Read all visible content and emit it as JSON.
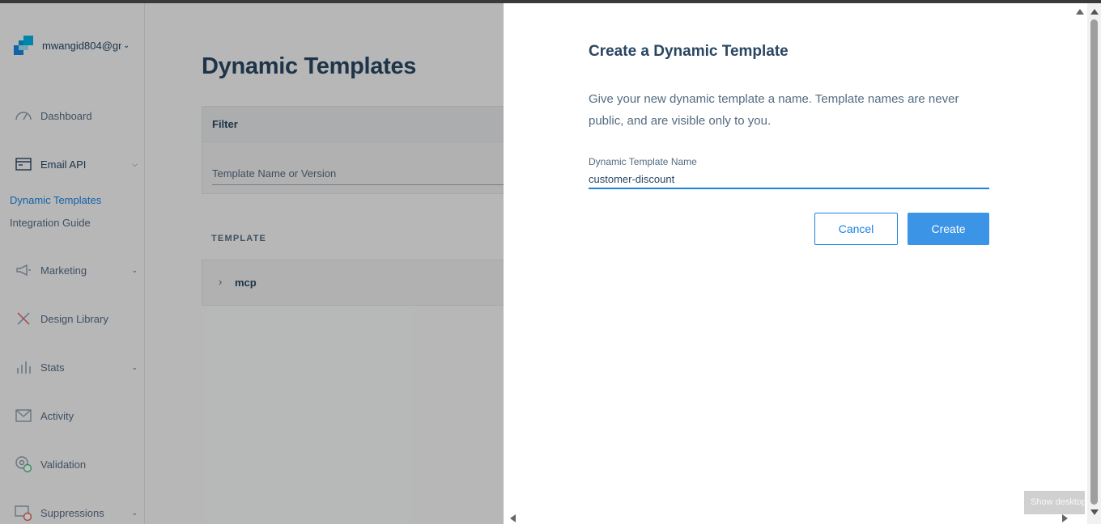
{
  "sidebar": {
    "account_name": "mwangid804@gn",
    "items": [
      {
        "label": "Dashboard",
        "icon": "dashboard-gauge-icon"
      },
      {
        "label": "Email API",
        "icon": "email-api-icon"
      },
      {
        "label": "Marketing",
        "icon": "megaphone-icon"
      },
      {
        "label": "Design Library",
        "icon": "design-tools-icon"
      },
      {
        "label": "Stats",
        "icon": "stats-bars-icon"
      },
      {
        "label": "Activity",
        "icon": "activity-envelope-icon"
      },
      {
        "label": "Validation",
        "icon": "validation-at-icon"
      },
      {
        "label": "Suppressions",
        "icon": "suppressions-icon"
      }
    ],
    "sub_items": [
      "Dynamic Templates",
      "Integration Guide"
    ]
  },
  "main": {
    "title": "Dynamic Templates",
    "filter_title": "Filter",
    "filter_placeholder": "Template Name or Version",
    "template_header": "TEMPLATE",
    "templates": [
      {
        "name": "mcp"
      }
    ]
  },
  "modal": {
    "title": "Create a Dynamic Template",
    "description": "Give your new dynamic template a name. Template names are never public, and are visible only to you.",
    "field_label": "Dynamic Template Name",
    "field_value": "customer-discount",
    "cancel_label": "Cancel",
    "create_label": "Create"
  },
  "taskbar": {
    "show_desktop": "Show desktop"
  },
  "colors": {
    "brand_blue": "#1a82e2",
    "heading": "#294661",
    "text": "#546b81"
  }
}
